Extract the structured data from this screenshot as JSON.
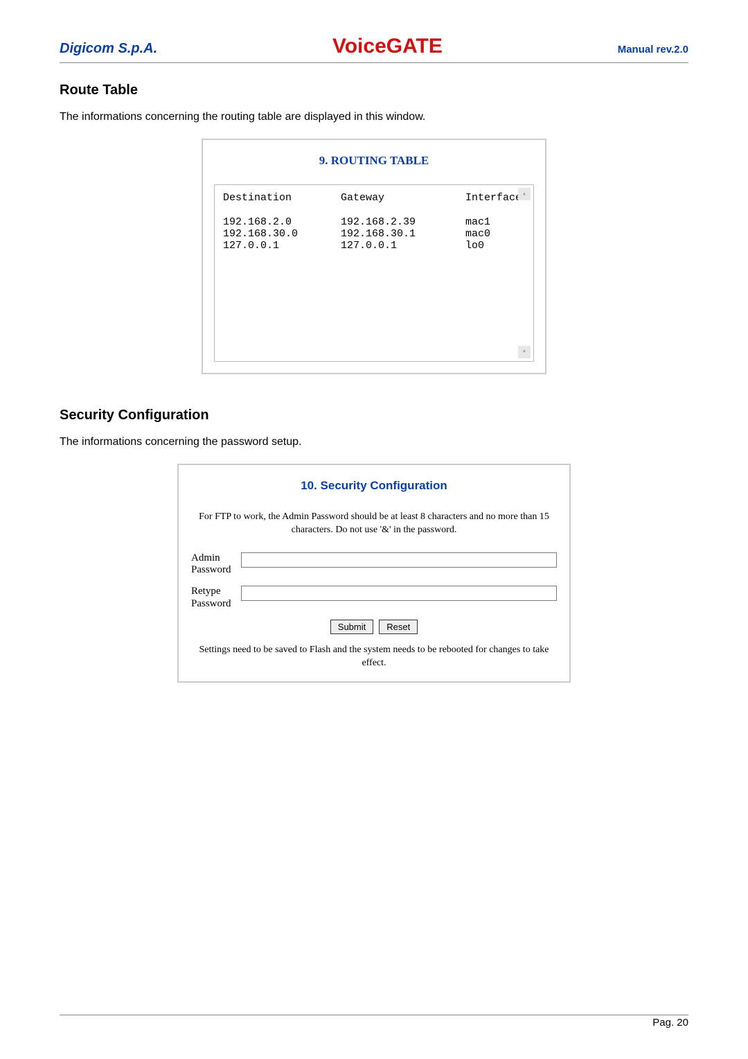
{
  "header": {
    "company": "Digicom S.p.A.",
    "product": "VoiceGATE",
    "revision": "Manual rev.2.0"
  },
  "routeTable": {
    "heading": "Route Table",
    "intro": "The informations concerning the routing table are displayed in this window.",
    "panelTitle": "9. ROUTING TABLE",
    "columns": {
      "destination": "Destination",
      "gateway": "Gateway",
      "interface": "Interface"
    },
    "rows": [
      {
        "destination": "192.168.2.0",
        "gateway": "192.168.2.39",
        "interface": "mac1"
      },
      {
        "destination": "192.168.30.0",
        "gateway": "192.168.30.1",
        "interface": "mac0"
      },
      {
        "destination": "127.0.0.1",
        "gateway": "127.0.0.1",
        "interface": "lo0"
      }
    ]
  },
  "security": {
    "heading": "Security Configuration",
    "intro": "The informations concerning the password setup.",
    "panelTitle": "10. Security Configuration",
    "note": "For FTP to work, the Admin Password should be at least 8 characters and no more than 15 characters. Do not use '&' in the password.",
    "fields": {
      "admin_l1": "Admin",
      "admin_l2": "Password",
      "retype_l1": "Retype",
      "retype_l2": "Password"
    },
    "buttons": {
      "submit": "Submit",
      "reset": "Reset"
    },
    "footer": "Settings need to be saved to Flash and the system needs to be rebooted for changes to take effect."
  },
  "page": {
    "number": "Pag. 20"
  }
}
